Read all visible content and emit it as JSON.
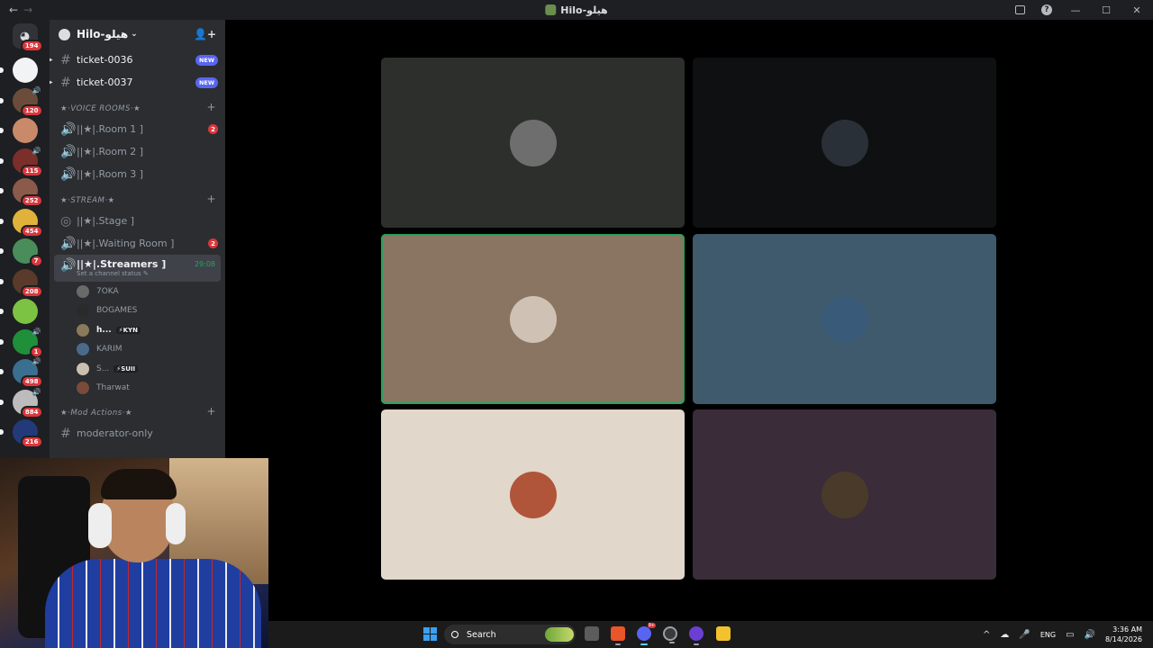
{
  "window": {
    "title": "Hilo-هيلو",
    "nav_back": "←",
    "nav_forward": "→",
    "controls": {
      "minimize": "—",
      "maximize": "☐",
      "close": "✕",
      "help": "?"
    }
  },
  "server_rail": {
    "home_badge": "194",
    "servers": [
      {
        "color": "#f2f3f5",
        "badge": "",
        "speaker": false
      },
      {
        "color": "#6b4c3b",
        "badge": "120",
        "speaker": true
      },
      {
        "color": "#c98a6a",
        "badge": "",
        "speaker": false
      },
      {
        "color": "#7a2f2a",
        "badge": "115",
        "speaker": true
      },
      {
        "color": "#8b5a4a",
        "badge": "252",
        "speaker": false
      },
      {
        "color": "#e0b23a",
        "badge": "454",
        "speaker": false
      },
      {
        "color": "#4a8d5a",
        "badge": "7",
        "speaker": false
      },
      {
        "color": "#5a3a2a",
        "badge": "208",
        "speaker": false
      },
      {
        "color": "#7cc243",
        "badge": "",
        "speaker": false
      },
      {
        "color": "#1f8f3a",
        "badge": "1",
        "speaker": true
      },
      {
        "color": "#3b6f8f",
        "badge": "498",
        "speaker": true
      },
      {
        "color": "#bcbcbc",
        "badge": "884",
        "speaker": true
      },
      {
        "color": "#223a7a",
        "badge": "216",
        "speaker": false
      }
    ]
  },
  "guild": {
    "name": "Hilo-هيلو",
    "chevron": "⌄",
    "invite_icon": "👤+"
  },
  "channels": {
    "tickets": [
      {
        "name": "ticket-0036",
        "badge": "NEW"
      },
      {
        "name": "ticket-0037",
        "badge": "NEW"
      }
    ],
    "voice_category": "★·VOICE ROOMS·★",
    "voice": [
      {
        "name": "||★|.Room 1 ]",
        "count": "2"
      },
      {
        "name": "||★|.Room 2 ]",
        "count": ""
      },
      {
        "name": "||★|.Room 3 ]",
        "count": ""
      }
    ],
    "stream_category": "★·STREAM·★",
    "stage": {
      "name": "||★|.Stage ]"
    },
    "waiting": {
      "name": "||★|.Waiting Room ]",
      "count": "2"
    },
    "streamers": {
      "name": "||★|.Streamers ]",
      "timer": "29:08",
      "status": "Set a channel status ✎"
    },
    "members": [
      {
        "name": "7OKA",
        "color": "#6a6a6a",
        "tag": "",
        "highlight": false
      },
      {
        "name": "BOGAMES",
        "color": "#2a2a2a",
        "tag": "",
        "highlight": false
      },
      {
        "name": "h...",
        "color": "#8a7a5a",
        "tag": "⚡KYN",
        "highlight": true
      },
      {
        "name": "KARIM",
        "color": "#4a6a8a",
        "tag": "",
        "highlight": false
      },
      {
        "name": "S...",
        "color": "#c9c0b0",
        "tag": "⚡SUII",
        "highlight": false
      },
      {
        "name": "Tharwat",
        "color": "#7a4a3a",
        "tag": "",
        "highlight": false
      }
    ],
    "mod_category": "★·Mod Actions·★",
    "mod": [
      {
        "name": "moderator-only"
      }
    ],
    "plus": "+"
  },
  "video_grid": {
    "tiles": [
      {
        "bg": "#2c2f2b",
        "avatar": "#6e6e6e",
        "speaking": false
      },
      {
        "bg": "#0f1011",
        "avatar": "#2a3038",
        "speaking": false
      },
      {
        "bg": "#8a7562",
        "avatar": "#cfc2b4",
        "speaking": true
      },
      {
        "bg": "#3e5a6c",
        "avatar": "#3a5a7a",
        "speaking": false
      },
      {
        "bg": "#e1d7ca",
        "avatar": "#b0553a",
        "speaking": false
      },
      {
        "bg": "#3a2c38",
        "avatar": "#4a3a2a",
        "speaking": false
      }
    ]
  },
  "taskbar": {
    "search_label": "Search",
    "discord_badge": "9+",
    "language": "ENG",
    "time": "3:36 AM",
    "date": "8/14/2026",
    "tray_chevron": "^"
  }
}
